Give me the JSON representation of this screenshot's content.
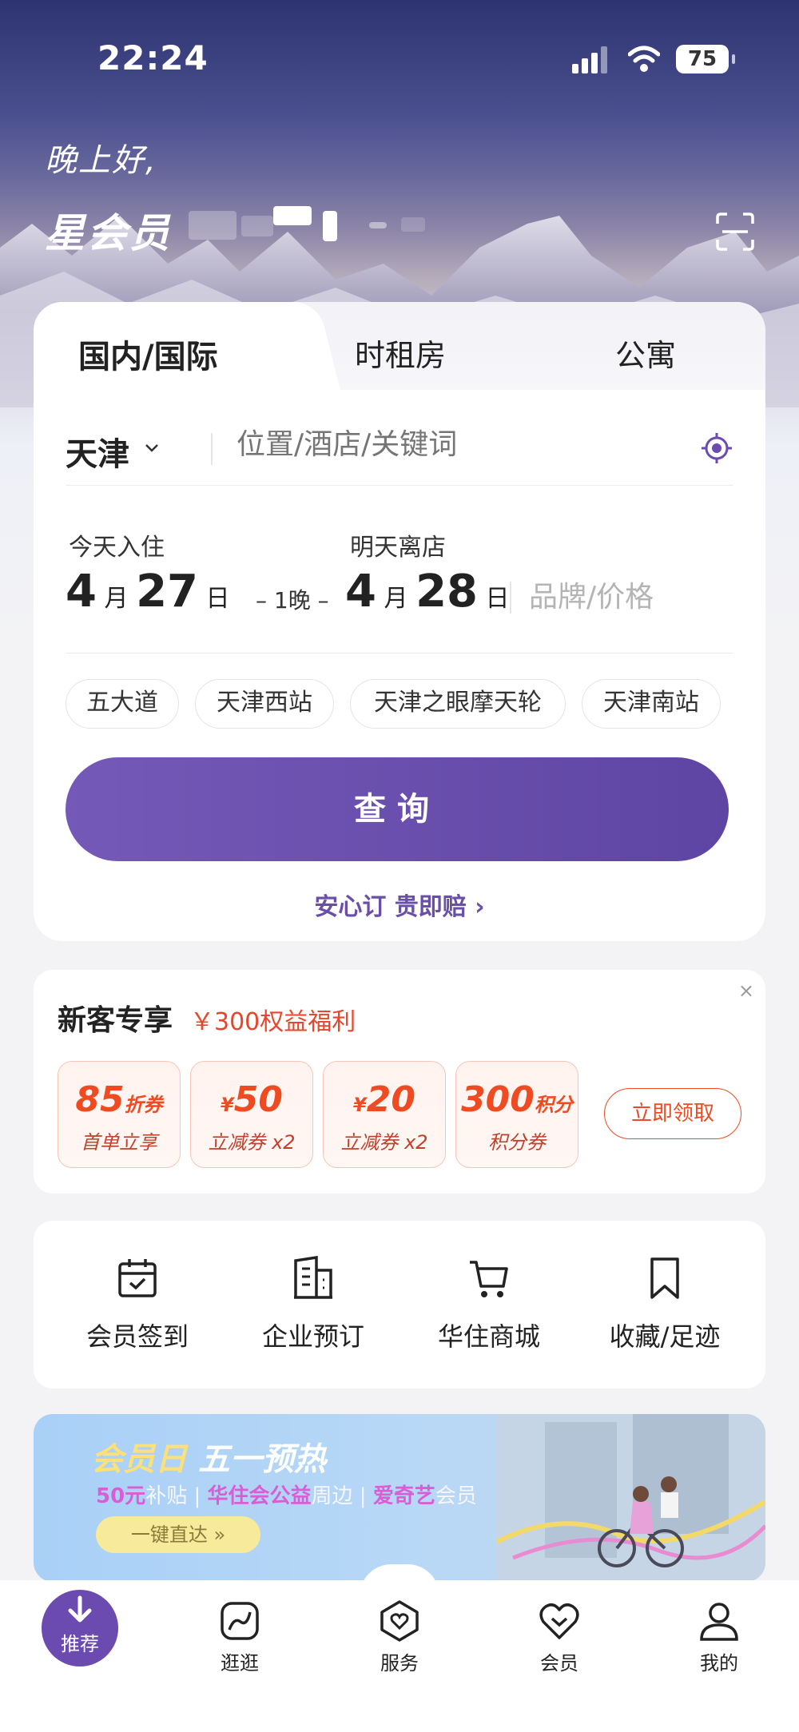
{
  "status_bar": {
    "time": "22:24",
    "battery": "75"
  },
  "header": {
    "greeting": "晚上好,",
    "member_level": "星会员"
  },
  "booking": {
    "tabs": [
      "国内/国际",
      "时租房",
      "公寓"
    ],
    "city": "天津",
    "search_placeholder": "位置/酒店/关键词",
    "checkin_label": "今天入住",
    "checkin_month": "4",
    "checkin_day": "27",
    "checkout_label": "明天离店",
    "checkout_month": "4",
    "checkout_day": "28",
    "month_unit": "月",
    "day_unit": "日",
    "nights": "1晚",
    "brand_price": "品牌/价格",
    "chips": [
      "五大道",
      "天津西站",
      "天津之眼摩天轮",
      "天津南站"
    ],
    "query_button": "查询",
    "assurance": "安心订 贵即赔 ›"
  },
  "promo": {
    "title": "新客专享",
    "subtitle": "￥300权益福利",
    "close": "×",
    "coupons": [
      {
        "value": "85",
        "unit": "折券",
        "desc": "首单立享"
      },
      {
        "value": "50",
        "unit": "¥",
        "desc": "立减券 x2"
      },
      {
        "value": "20",
        "unit": "¥",
        "desc": "立减券 x2"
      },
      {
        "value": "300",
        "unit": "积分",
        "desc": "积分券"
      }
    ],
    "claim_button": "立即领取"
  },
  "quick_menu": [
    {
      "label": "会员签到",
      "icon": "calendar-check-icon"
    },
    {
      "label": "企业预订",
      "icon": "building-icon"
    },
    {
      "label": "华住商城",
      "icon": "cart-icon"
    },
    {
      "label": "收藏/足迹",
      "icon": "bookmark-icon"
    }
  ],
  "banner": {
    "title_highlight": "会员日",
    "title": "五一预热",
    "sub_1_hl": "50元",
    "sub_1": "补贴",
    "sub_2_hl": "华住会公益",
    "sub_2": "周边",
    "sub_3_hl": "爱奇艺",
    "sub_3": "会员",
    "separator": "|",
    "button": "一键直达 »"
  },
  "bottom_nav": [
    {
      "label": "推荐",
      "icon": "download-arrow-icon",
      "active": true
    },
    {
      "label": "逛逛",
      "icon": "discover-icon"
    },
    {
      "label": "服务",
      "icon": "service-heart-icon"
    },
    {
      "label": "会员",
      "icon": "member-heart-icon"
    },
    {
      "label": "我的",
      "icon": "profile-icon"
    }
  ],
  "colors": {
    "accent": "#6b4bb0",
    "promo_red": "#ef4b22"
  }
}
